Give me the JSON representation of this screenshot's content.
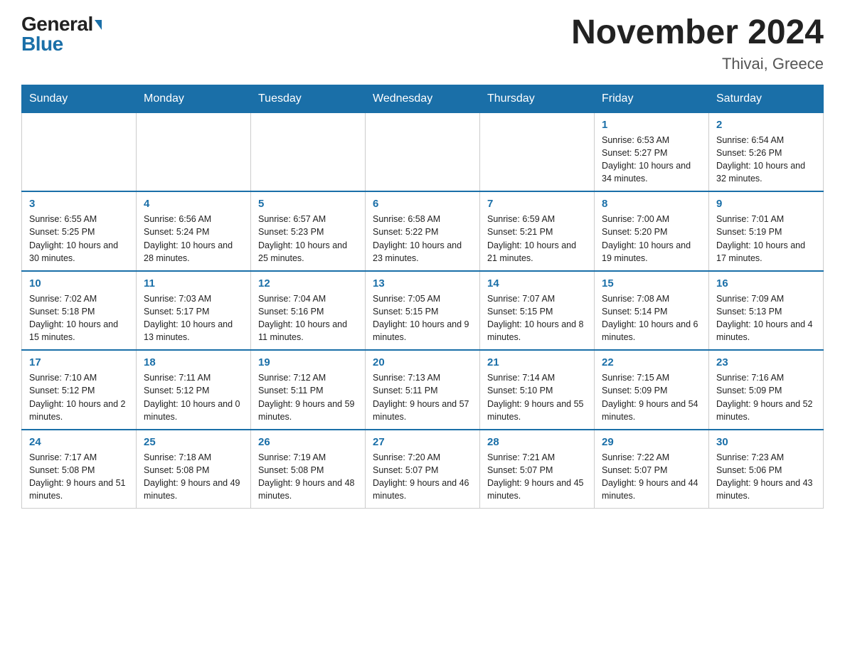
{
  "header": {
    "logo_general": "General",
    "logo_blue": "Blue",
    "title": "November 2024",
    "subtitle": "Thivai, Greece"
  },
  "days_of_week": [
    "Sunday",
    "Monday",
    "Tuesday",
    "Wednesday",
    "Thursday",
    "Friday",
    "Saturday"
  ],
  "weeks": [
    [
      {
        "day": "",
        "info": ""
      },
      {
        "day": "",
        "info": ""
      },
      {
        "day": "",
        "info": ""
      },
      {
        "day": "",
        "info": ""
      },
      {
        "day": "",
        "info": ""
      },
      {
        "day": "1",
        "info": "Sunrise: 6:53 AM\nSunset: 5:27 PM\nDaylight: 10 hours\nand 34 minutes."
      },
      {
        "day": "2",
        "info": "Sunrise: 6:54 AM\nSunset: 5:26 PM\nDaylight: 10 hours\nand 32 minutes."
      }
    ],
    [
      {
        "day": "3",
        "info": "Sunrise: 6:55 AM\nSunset: 5:25 PM\nDaylight: 10 hours\nand 30 minutes."
      },
      {
        "day": "4",
        "info": "Sunrise: 6:56 AM\nSunset: 5:24 PM\nDaylight: 10 hours\nand 28 minutes."
      },
      {
        "day": "5",
        "info": "Sunrise: 6:57 AM\nSunset: 5:23 PM\nDaylight: 10 hours\nand 25 minutes."
      },
      {
        "day": "6",
        "info": "Sunrise: 6:58 AM\nSunset: 5:22 PM\nDaylight: 10 hours\nand 23 minutes."
      },
      {
        "day": "7",
        "info": "Sunrise: 6:59 AM\nSunset: 5:21 PM\nDaylight: 10 hours\nand 21 minutes."
      },
      {
        "day": "8",
        "info": "Sunrise: 7:00 AM\nSunset: 5:20 PM\nDaylight: 10 hours\nand 19 minutes."
      },
      {
        "day": "9",
        "info": "Sunrise: 7:01 AM\nSunset: 5:19 PM\nDaylight: 10 hours\nand 17 minutes."
      }
    ],
    [
      {
        "day": "10",
        "info": "Sunrise: 7:02 AM\nSunset: 5:18 PM\nDaylight: 10 hours\nand 15 minutes."
      },
      {
        "day": "11",
        "info": "Sunrise: 7:03 AM\nSunset: 5:17 PM\nDaylight: 10 hours\nand 13 minutes."
      },
      {
        "day": "12",
        "info": "Sunrise: 7:04 AM\nSunset: 5:16 PM\nDaylight: 10 hours\nand 11 minutes."
      },
      {
        "day": "13",
        "info": "Sunrise: 7:05 AM\nSunset: 5:15 PM\nDaylight: 10 hours\nand 9 minutes."
      },
      {
        "day": "14",
        "info": "Sunrise: 7:07 AM\nSunset: 5:15 PM\nDaylight: 10 hours\nand 8 minutes."
      },
      {
        "day": "15",
        "info": "Sunrise: 7:08 AM\nSunset: 5:14 PM\nDaylight: 10 hours\nand 6 minutes."
      },
      {
        "day": "16",
        "info": "Sunrise: 7:09 AM\nSunset: 5:13 PM\nDaylight: 10 hours\nand 4 minutes."
      }
    ],
    [
      {
        "day": "17",
        "info": "Sunrise: 7:10 AM\nSunset: 5:12 PM\nDaylight: 10 hours\nand 2 minutes."
      },
      {
        "day": "18",
        "info": "Sunrise: 7:11 AM\nSunset: 5:12 PM\nDaylight: 10 hours\nand 0 minutes."
      },
      {
        "day": "19",
        "info": "Sunrise: 7:12 AM\nSunset: 5:11 PM\nDaylight: 9 hours\nand 59 minutes."
      },
      {
        "day": "20",
        "info": "Sunrise: 7:13 AM\nSunset: 5:11 PM\nDaylight: 9 hours\nand 57 minutes."
      },
      {
        "day": "21",
        "info": "Sunrise: 7:14 AM\nSunset: 5:10 PM\nDaylight: 9 hours\nand 55 minutes."
      },
      {
        "day": "22",
        "info": "Sunrise: 7:15 AM\nSunset: 5:09 PM\nDaylight: 9 hours\nand 54 minutes."
      },
      {
        "day": "23",
        "info": "Sunrise: 7:16 AM\nSunset: 5:09 PM\nDaylight: 9 hours\nand 52 minutes."
      }
    ],
    [
      {
        "day": "24",
        "info": "Sunrise: 7:17 AM\nSunset: 5:08 PM\nDaylight: 9 hours\nand 51 minutes."
      },
      {
        "day": "25",
        "info": "Sunrise: 7:18 AM\nSunset: 5:08 PM\nDaylight: 9 hours\nand 49 minutes."
      },
      {
        "day": "26",
        "info": "Sunrise: 7:19 AM\nSunset: 5:08 PM\nDaylight: 9 hours\nand 48 minutes."
      },
      {
        "day": "27",
        "info": "Sunrise: 7:20 AM\nSunset: 5:07 PM\nDaylight: 9 hours\nand 46 minutes."
      },
      {
        "day": "28",
        "info": "Sunrise: 7:21 AM\nSunset: 5:07 PM\nDaylight: 9 hours\nand 45 minutes."
      },
      {
        "day": "29",
        "info": "Sunrise: 7:22 AM\nSunset: 5:07 PM\nDaylight: 9 hours\nand 44 minutes."
      },
      {
        "day": "30",
        "info": "Sunrise: 7:23 AM\nSunset: 5:06 PM\nDaylight: 9 hours\nand 43 minutes."
      }
    ]
  ]
}
